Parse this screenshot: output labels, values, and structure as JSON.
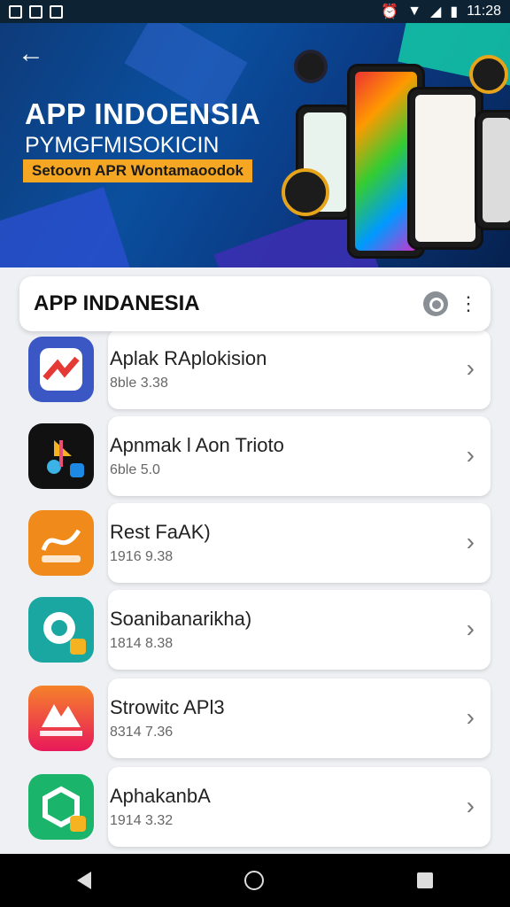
{
  "status_bar": {
    "time": "11:28"
  },
  "banner": {
    "title": "APP INDOENSIA",
    "subtitle": "PYMGFMISOKICIN",
    "tagline": "Setoovn APR Wontamaoodok"
  },
  "header": {
    "title": "APP INDANESIA"
  },
  "apps": [
    {
      "name": "Aplak RAplokision",
      "meta": "8ble 3.38",
      "icon": "red-chart-icon",
      "color": "#3a57c4"
    },
    {
      "name": "Apnmak l Aon Trioto",
      "meta": "6ble 5.0",
      "icon": "music-note-icon",
      "color": "#111111"
    },
    {
      "name": "Rest FaAK)",
      "meta": "1916 9.38",
      "icon": "orange-logo-icon",
      "color": "#f08a1a"
    },
    {
      "name": "Soanibanarikha)",
      "meta": "1814 8.38",
      "icon": "chat-bubble-icon",
      "color": "#1aa7a2"
    },
    {
      "name": "Strowitc APl3",
      "meta": "8314 7.36",
      "icon": "mountain-logo-icon",
      "color": "#f25a3a"
    },
    {
      "name": "AphakanbA",
      "meta": "1914 3.32",
      "icon": "hex-logo-icon",
      "color": "#1ab56b"
    }
  ]
}
